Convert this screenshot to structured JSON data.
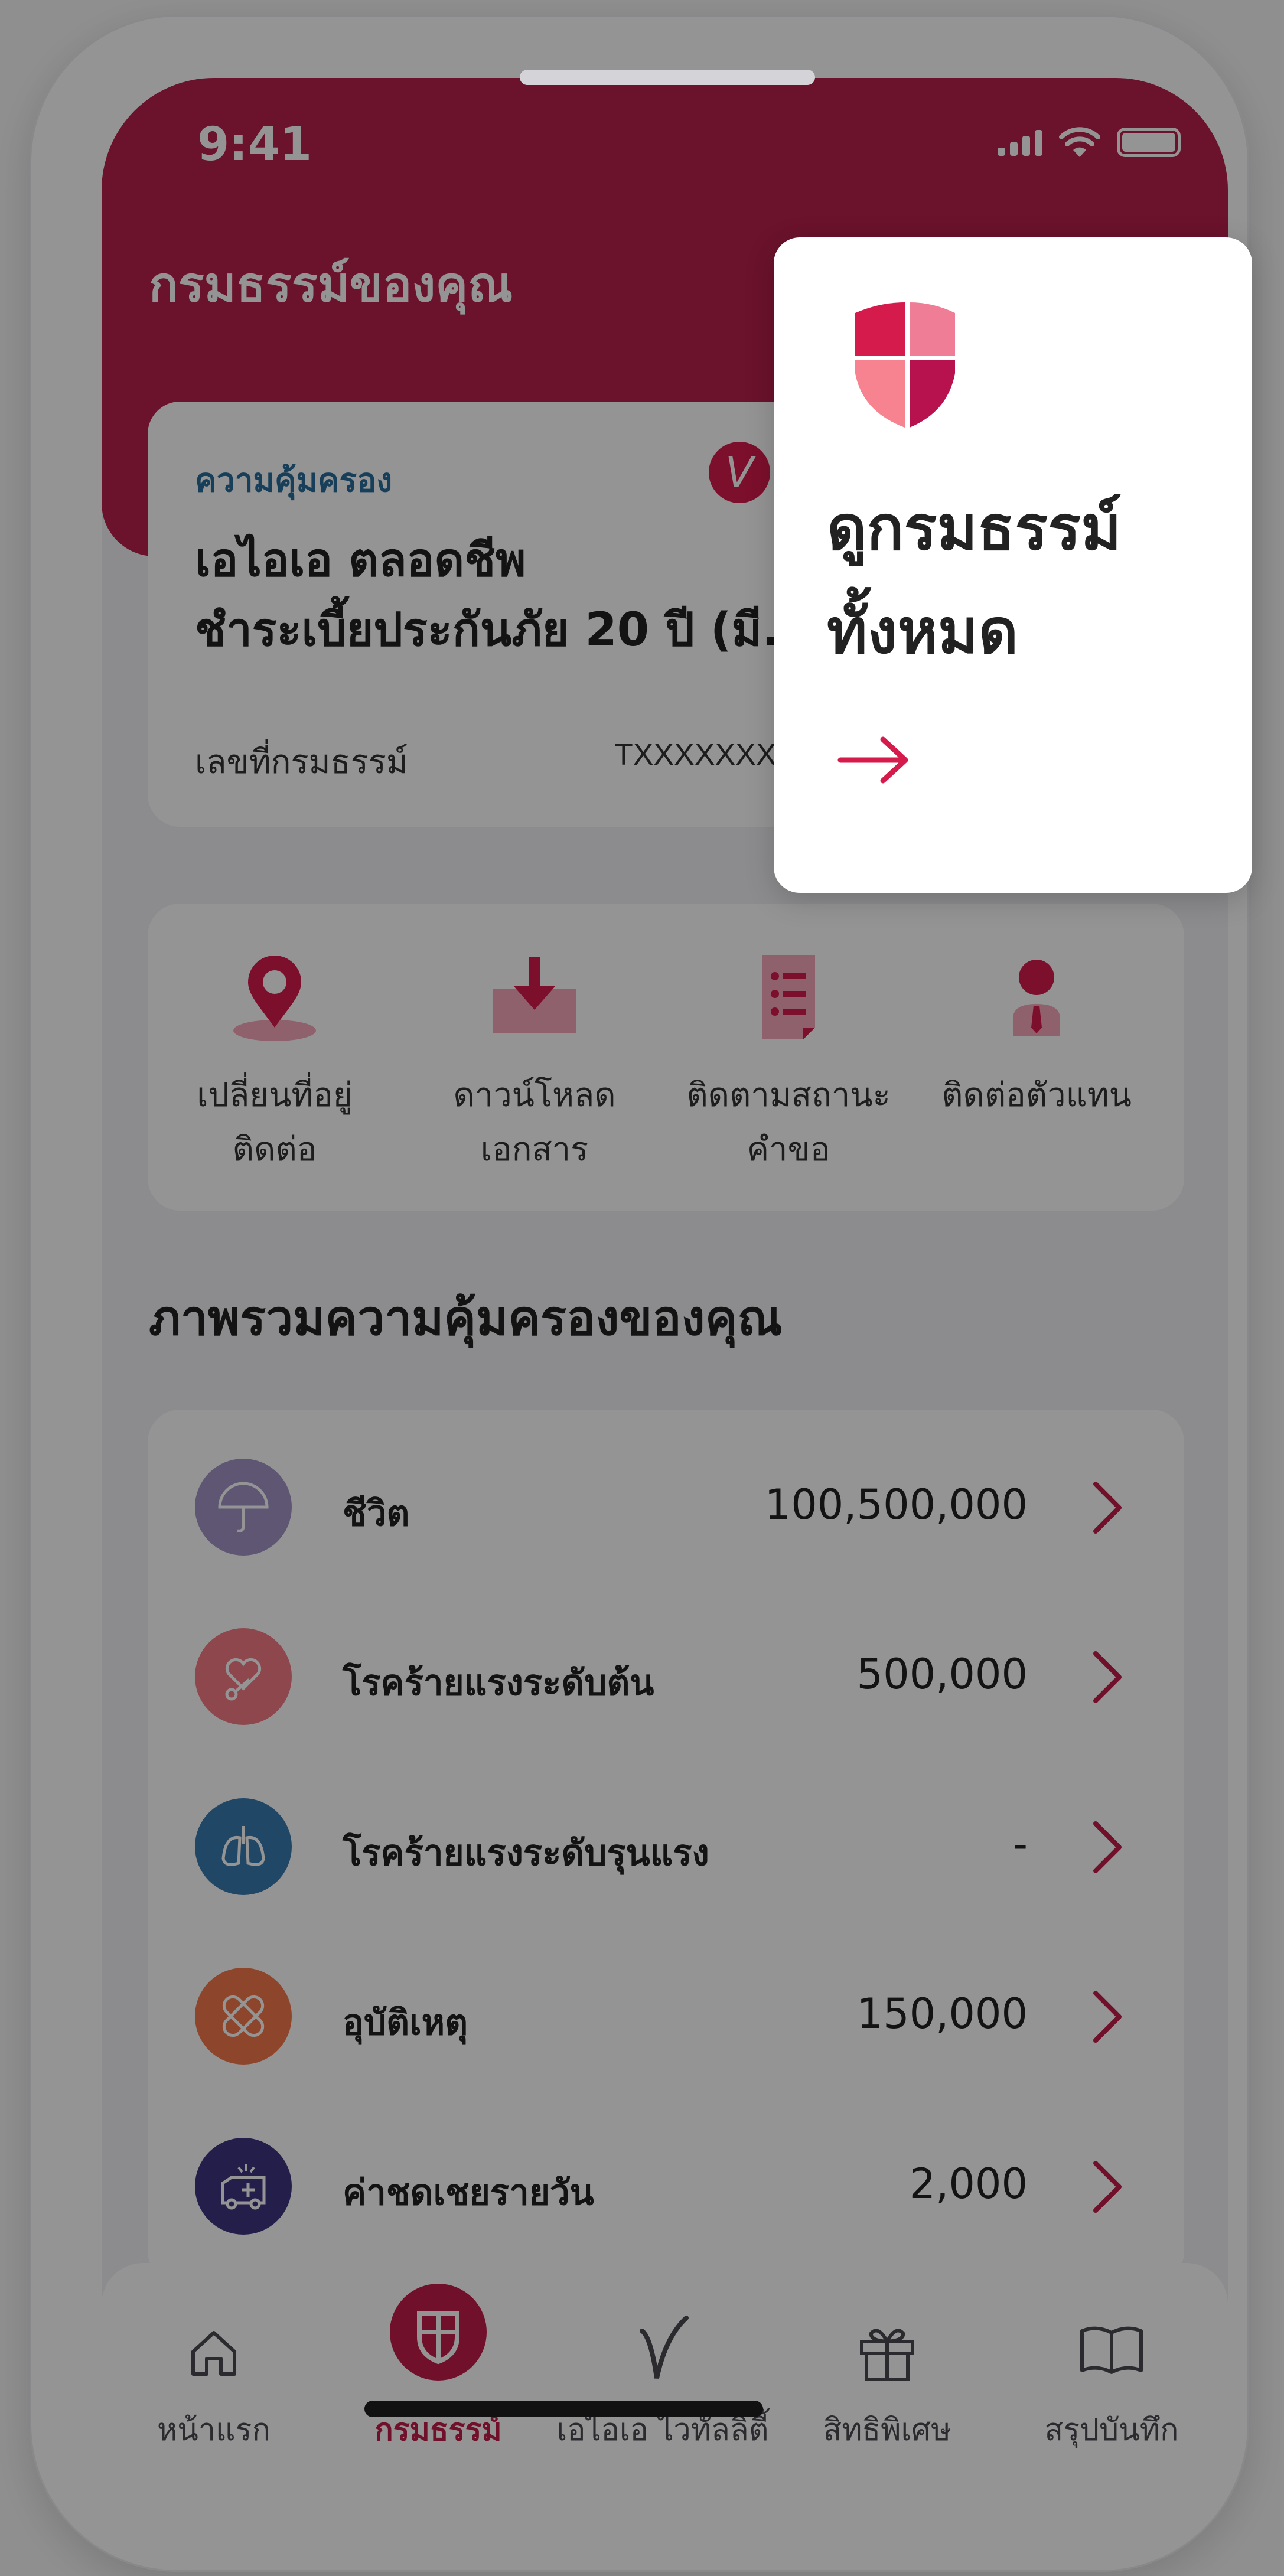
{
  "status": {
    "time": "9:41"
  },
  "header": {
    "title": "กรมธรรม์ของคุณ"
  },
  "policy_card": {
    "coverage_label": "ความคุ้มครอง",
    "badge": "V",
    "name_line1": "เอไอเอ ตลอดชีพ",
    "name_line2": "ชำระเบี้ยประกันภัย 20 ปี (มี...",
    "number_label": "เลขที่กรมธรรม์",
    "number_value": "TXXXXXXXXX"
  },
  "quick_actions": [
    {
      "line1": "เปลี่ยนที่อยู่",
      "line2": "ติดต่อ",
      "icon": "location-pin-icon"
    },
    {
      "line1": "ดาวน์โหลด",
      "line2": "เอกสาร",
      "icon": "download-icon"
    },
    {
      "line1": "ติดตามสถานะ",
      "line2": "คำขอ",
      "icon": "document-list-icon"
    },
    {
      "line1": "ติดต่อตัวแทน",
      "line2": "",
      "icon": "agent-icon"
    }
  ],
  "coverage_section": {
    "title": "ภาพรวมความคุ้มครองของคุณ",
    "items": [
      {
        "name": "ชีวิต",
        "amount": "100,500,000",
        "icon": "umbrella-icon",
        "color": "#a394c6"
      },
      {
        "name": "โรคร้ายแรงระดับต้น",
        "amount": "500,000",
        "icon": "heart-stethoscope-icon",
        "color": "#f47c86"
      },
      {
        "name": "โรคร้ายแรงระดับรุนแรง",
        "amount": "-",
        "icon": "lungs-icon",
        "color": "#3a7ab0"
      },
      {
        "name": "อุบัติเหตุ",
        "amount": "150,000",
        "icon": "bandage-icon",
        "color": "#f3784c"
      },
      {
        "name": "ค่าชดเชยรายวัน",
        "amount": "2,000",
        "icon": "ambulance-icon",
        "color": "#3e3582"
      }
    ]
  },
  "tabbar": {
    "tabs": [
      {
        "label": "หน้าแรก",
        "icon": "home-icon",
        "active": false
      },
      {
        "label": "กรมธรรม์",
        "icon": "shield-icon",
        "active": true
      },
      {
        "label": "เอไอเอ ไวทัลลิตี้",
        "icon": "vitality-icon",
        "active": false
      },
      {
        "label": "สิทธิพิเศษ",
        "icon": "gift-icon",
        "active": false
      },
      {
        "label": "สรุปบันทึก",
        "icon": "book-icon",
        "active": false
      }
    ]
  },
  "coachmark": {
    "line1": "ดูกรมธรรม์",
    "line2": "ทั้งหมด",
    "arrow_icon": "arrow-right-icon"
  },
  "colors": {
    "brand": "#b81f4c",
    "accent": "#d51a4c",
    "overlay": "rgba(0,0,0,0.42)"
  }
}
